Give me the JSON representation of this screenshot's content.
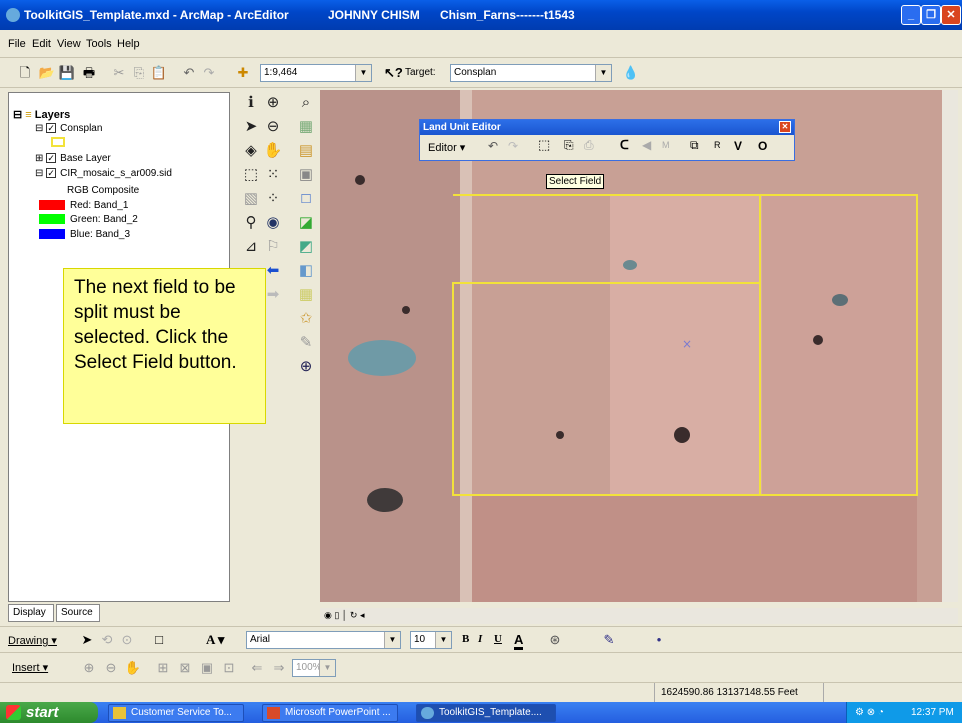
{
  "window": {
    "app_title": "ToolkitGIS_Template.mxd - ArcMap - ArcEditor",
    "user": "JOHNNY CHISM",
    "file": "Chism_Farns-------t1543"
  },
  "menu": [
    "File",
    "Edit",
    "View",
    "Tools",
    "Help"
  ],
  "standard_toolbar": {
    "scale": "1:9,464",
    "target_label": "Target:",
    "target_value": "Consplan"
  },
  "toc": {
    "root": "Layers",
    "layers": [
      {
        "name": "Consplan",
        "checked": true
      },
      {
        "name": "Base Layer",
        "checked": true
      },
      {
        "name": "CIR_mosaic_s_ar009.sid",
        "checked": true
      }
    ],
    "rgb_label": "RGB Composite",
    "bands": [
      {
        "label": "Red:   Band_1",
        "color": "#ff0000"
      },
      {
        "label": "Green: Band_2",
        "color": "#00ff00"
      },
      {
        "label": "Blue:  Band_3",
        "color": "#0000ff"
      }
    ],
    "tabs": [
      "Display",
      "Source"
    ]
  },
  "note": "The next field to be split must be selected. Click the Select Field button.",
  "land_unit_editor": {
    "title": "Land Unit Editor",
    "editor_menu": "Editor",
    "letters": [
      "M",
      "R",
      "V",
      "O"
    ]
  },
  "tooltip": "Select Field",
  "drawing_toolbar": {
    "drawing": "Drawing",
    "font": "Arial",
    "size": "10",
    "bold": "B",
    "italic": "I",
    "underline": "U",
    "font_color": "A"
  },
  "insert_toolbar": {
    "insert": "Insert",
    "zoom": "100%"
  },
  "status": {
    "coords": "1624590.86  13137148.55 Feet"
  },
  "taskbar": {
    "start": "start",
    "tasks": [
      "Customer Service To...",
      "Microsoft PowerPoint ...",
      "ToolkitGIS_Template...."
    ],
    "time": "12:37 PM"
  },
  "colors": {
    "field_outline": "#f2e23a",
    "title_blue": "#0046c8",
    "note_bg": "#ffff99"
  }
}
